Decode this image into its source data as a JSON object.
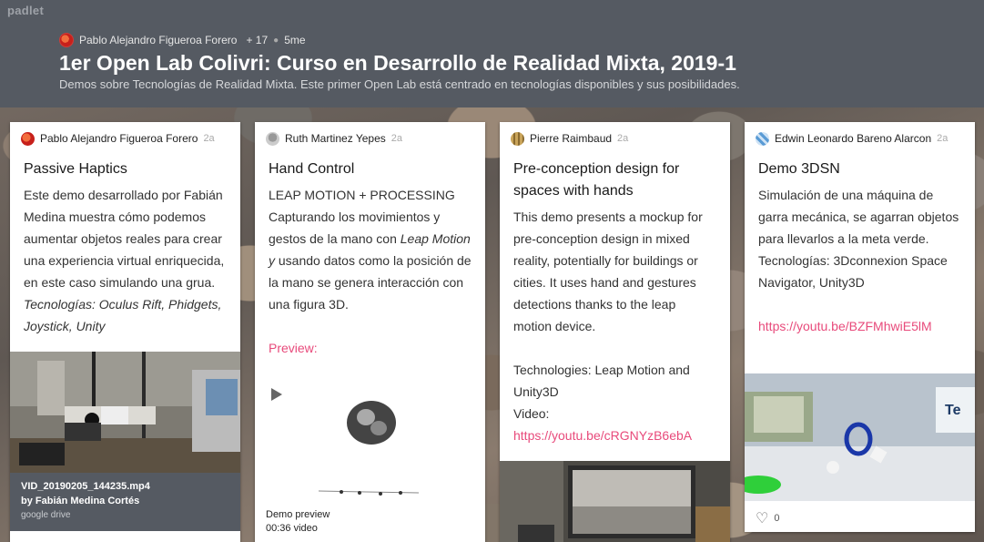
{
  "brand": "padlet",
  "header": {
    "author": "Pablo Alejandro Figueroa Forero",
    "likes": "+ 17",
    "time": "5me",
    "title": "1er Open Lab Colivri: Curso en Desarrollo de Realidad Mixta, 2019-1",
    "subtitle": "Demos sobre Tecnologías de Realidad Mixta. Este primer Open Lab está centrado en tecnologías disponibles y sus posibilidades."
  },
  "cards": [
    {
      "author": "Pablo Alejandro Figueroa Forero",
      "ago": "2a",
      "title": "Passive Haptics",
      "body_plain": "Este demo desarrollado por Fabián Medina muestra cómo podemos aumentar objetos reales para crear una experiencia virtual enriquecida, en este caso simulando una grua.",
      "body_italic": "Tecnologías: Oculus Rift, Phidgets, Joystick, Unity",
      "attachment": {
        "name": "VID_20190205_144235.mp4",
        "by": "by Fabián Medina Cortés",
        "source": "google drive"
      }
    },
    {
      "author": "Ruth Martinez Yepes",
      "ago": "2a",
      "title": "Hand Control",
      "body_line1": "LEAP MOTION + PROCESSING",
      "body_part1": "Capturando los movimientos y gestos de la mano con ",
      "body_italic": "Leap Motion y",
      "body_part2": " usando datos como la posición de la mano se genera interacción con una figura 3D.",
      "preview_label": "Preview:",
      "attachment": {
        "name": "Demo preview",
        "duration": "00:36 video"
      }
    },
    {
      "author": "Pierre Raimbaud",
      "ago": "2a",
      "title": "Pre-conception design for spaces with hands",
      "body": "This demo presents a mockup for pre-conception design in mixed reality, potentially for buildings or cities. It uses hand and gestures detections thanks to the leap motion device.",
      "tech": "Technologies: Leap Motion and Unity3D",
      "video_label": "Video:",
      "link": "https://youtu.be/cRGNYzB6ebA"
    },
    {
      "author": "Edwin Leonardo Bareno Alarcon",
      "ago": "2a",
      "title": "Demo 3DSN",
      "body": "Simulación de una máquina de garra mecánica, se agarran objetos para llevarlos a la meta verde. Tecnologías: 3Dconnexion Space Navigator, Unity3D",
      "link": "https://youtu.be/BZFMhwiE5lM",
      "likes": "0"
    }
  ]
}
